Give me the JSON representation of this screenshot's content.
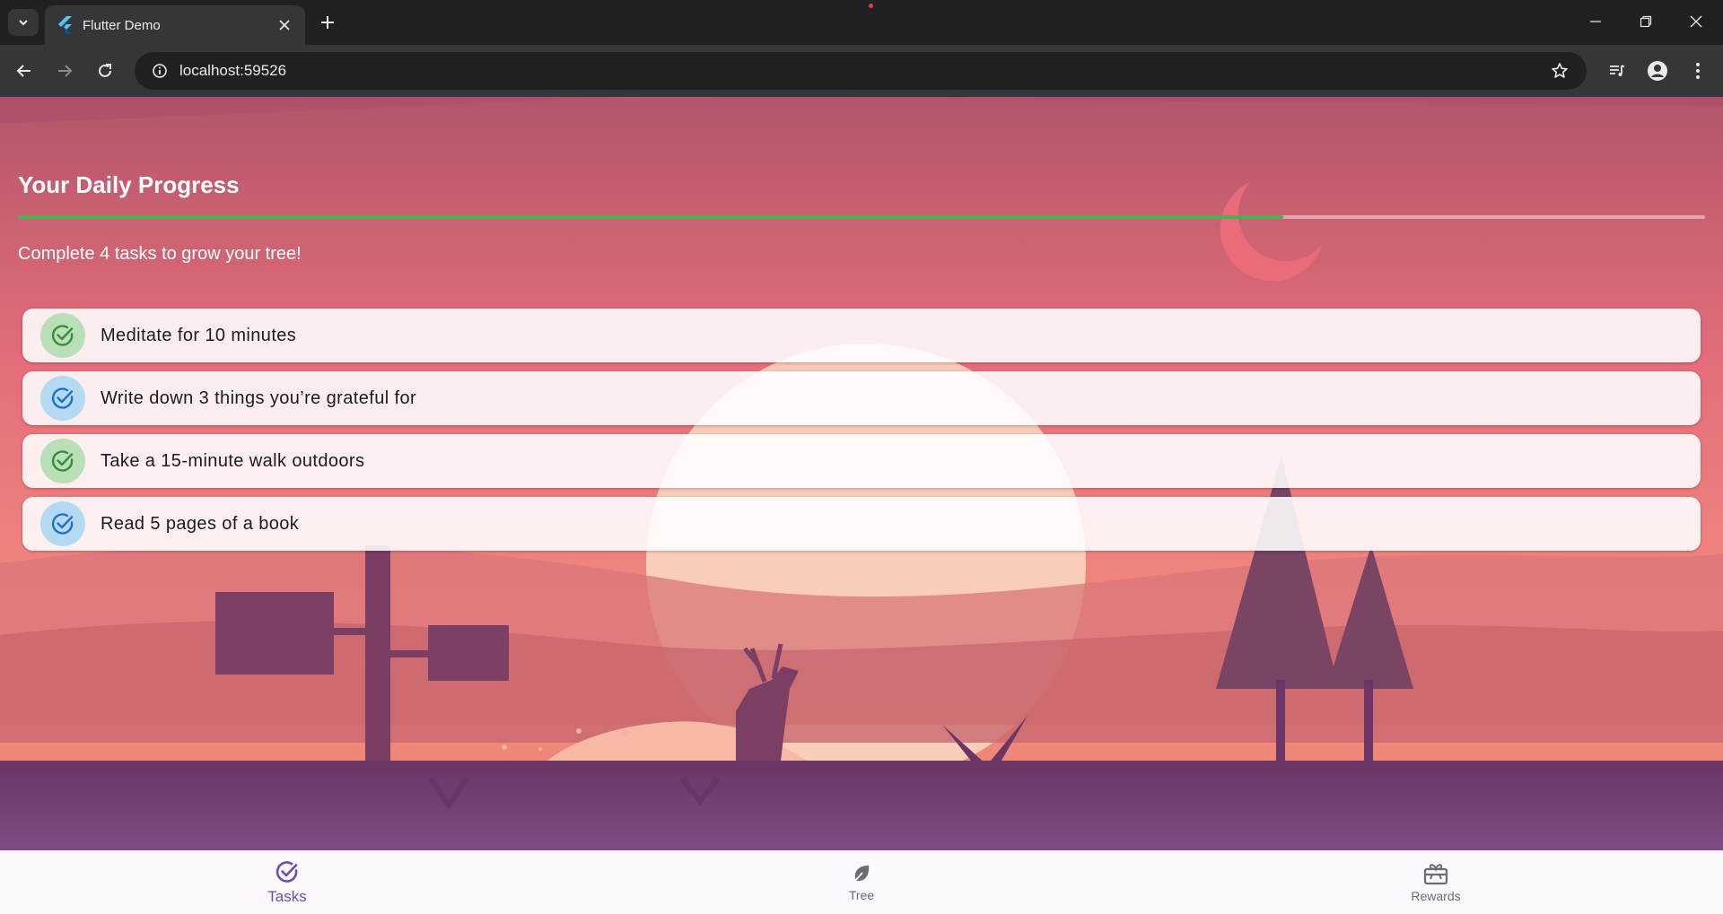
{
  "browser": {
    "tab_title": "Flutter Demo",
    "url": "localhost:59526"
  },
  "colors": {
    "progress": "#4caf50",
    "active_nav": "#6a4fa3",
    "sky_top": "#b3566a",
    "sky_bottom": "#f08a7e",
    "ground": "#6e3c6a"
  },
  "page": {
    "title": "Your Daily Progress",
    "progress_percent": 75,
    "subtitle": "Complete 4 tasks to grow your tree!"
  },
  "tasks": [
    {
      "label": "Meditate for 10 minutes",
      "icon": "check-circle-icon",
      "color": "green"
    },
    {
      "label": "Write down 3 things you’re grateful for",
      "icon": "check-circle-icon",
      "color": "blue"
    },
    {
      "label": "Take a 15-minute walk outdoors",
      "icon": "check-circle-icon",
      "color": "green"
    },
    {
      "label": "Read 5 pages of a book",
      "icon": "check-circle-icon",
      "color": "blue"
    }
  ],
  "bottom_nav": [
    {
      "label": "Tasks",
      "icon": "check-circle-icon",
      "active": true
    },
    {
      "label": "Tree",
      "icon": "leaf-icon",
      "active": false
    },
    {
      "label": "Rewards",
      "icon": "gift-icon",
      "active": false
    }
  ]
}
